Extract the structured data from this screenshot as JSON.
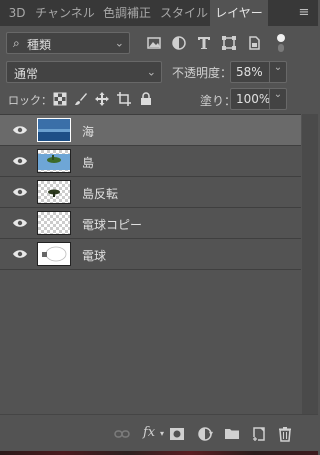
{
  "tabs": [
    {
      "label": "3D",
      "active": false
    },
    {
      "label": "チャンネル",
      "active": false
    },
    {
      "label": "色調補正",
      "active": false
    },
    {
      "label": "スタイル",
      "active": false
    },
    {
      "label": "レイヤー",
      "active": true
    }
  ],
  "filter": {
    "kind_label": "種類",
    "icons": [
      "pixel-filter-icon",
      "adjustment-filter-icon",
      "type-filter-icon",
      "shape-filter-icon",
      "smart-object-filter-icon"
    ]
  },
  "blend": {
    "mode": "通常",
    "opacity_label": "不透明度：",
    "opacity_value": "58%"
  },
  "lock": {
    "label": "ロック：",
    "fill_label": "塗り：",
    "fill_value": "100%"
  },
  "layers": [
    {
      "name": "海",
      "visible": true,
      "selected": true
    },
    {
      "name": "島",
      "visible": true,
      "selected": false
    },
    {
      "name": "島反転",
      "visible": true,
      "selected": false
    },
    {
      "name": "電球コピー",
      "visible": true,
      "selected": false
    },
    {
      "name": "電球",
      "visible": true,
      "selected": false
    }
  ],
  "footer_icons": [
    "link-layers-icon",
    "fx-icon",
    "add-mask-icon",
    "adjustment-layer-icon",
    "group-folder-icon",
    "new-layer-icon",
    "trash-icon"
  ],
  "colors": {
    "panel": "#535353",
    "tabbar": "#383838",
    "selected_layer": "#6a6a6a"
  }
}
